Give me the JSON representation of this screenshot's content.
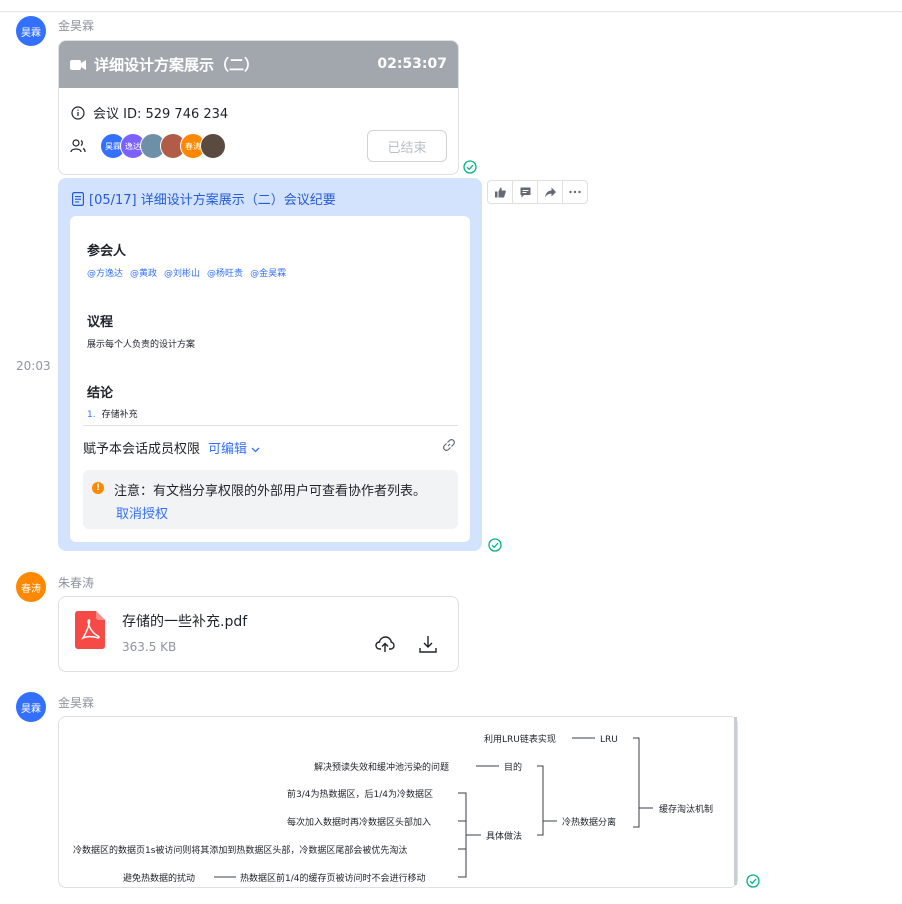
{
  "messages": {
    "m1": {
      "avatar_text": "昊霖",
      "sender": "金昊霖"
    },
    "m2": {
      "avatar_text": "春涛",
      "sender": "朱春涛"
    },
    "m3": {
      "avatar_text": "昊霖",
      "sender": "金昊霖"
    }
  },
  "timestamp": "20:03",
  "meeting": {
    "title": "详细设计方案展示（二）",
    "duration": "02:53:07",
    "id_label": "会议 ID: 529 746 234",
    "participants": [
      {
        "text": "昊霖",
        "color": "#3370ff"
      },
      {
        "text": "逸达",
        "color": "#7b61ff"
      },
      {
        "text": "",
        "color": "#6e8fa8"
      },
      {
        "text": "",
        "color": "#b15c47"
      },
      {
        "text": "春涛",
        "color": "#ff8800"
      },
      {
        "text": "",
        "color": "#5a4a3f"
      }
    ],
    "ended_button": "已结束"
  },
  "doc": {
    "title": "[05/17] 详细设计方案展示（二）会议纪要",
    "attendees_heading": "参会人",
    "attendees": [
      "@方逸达",
      "@黄政",
      "@刘彬山",
      "@杨旺贵",
      "@金昊霖"
    ],
    "agenda_heading": "议程",
    "agenda_text": "展示每个人负责的设计方案",
    "conclusion_heading": "结论",
    "conclusion_num": "1.",
    "conclusion_item": "存储补充",
    "permission_label": "赋予本会话成员权限",
    "permission_value": "可编辑",
    "notice_text": "注意：有文档分享权限的外部用户可查看协作者列表。",
    "notice_link": "取消授权"
  },
  "file": {
    "name": "存储的一些补充.pdf",
    "size": "363.5 KB"
  },
  "mindmap": {
    "root": "缓存淘汰机制",
    "lru": "LRU",
    "lru_impl": "利用LRU链表实现",
    "hotcold": "冷热数据分离",
    "goal": "目的",
    "goal_detail": "解决预读失效和缓冲池污染的问题",
    "method": "具体做法",
    "method_1": "前3/4为热数据区，后1/4为冷数据区",
    "method_2": "每次加入数据时再冷数据区头部加入",
    "method_3": "冷数据区的数据页1s被访问则将其添加到热数据区头部，冷数据区尾部会被优先淘汰",
    "method_4": "热数据区前1/4的缓存页被访问时不会进行移动",
    "method_4_note": "避免热数据的扰动"
  },
  "colors": {
    "accent": "#3370ff",
    "read": "#00b386",
    "meeting_header": "#a2a7ae",
    "doc_bg": "#d3e3fd"
  }
}
